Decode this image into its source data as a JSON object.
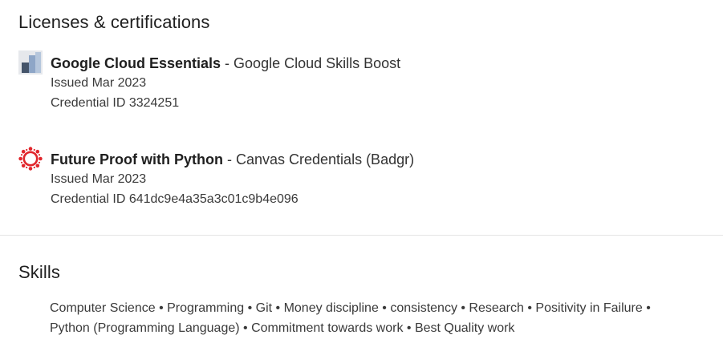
{
  "licenses": {
    "title": "Licenses & certifications",
    "items": [
      {
        "name": "Google Cloud Essentials",
        "separator": " - ",
        "issuer": "Google Cloud Skills Boost",
        "issued": "Issued Mar 2023",
        "credential": "Credential ID 3324251",
        "logo_icon": "google-cloud-skills-boost-logo"
      },
      {
        "name": "Future Proof with Python",
        "separator": " - ",
        "issuer": "Canvas Credentials (Badgr)",
        "issued": "Issued Mar 2023",
        "credential": "Credential ID 641dc9e4a35a3c01c9b4e096",
        "logo_icon": "canvas-credentials-logo"
      }
    ]
  },
  "skills": {
    "title": "Skills",
    "line1": "Computer Science • Programming • Git • Money discipline • consistency • Research • Positivity in Failure •",
    "line2": "Python (Programming Language) • Commitment towards work • Best Quality work"
  },
  "colors": {
    "text_primary": "#1f1f1f",
    "text_secondary": "#3a3a3a",
    "divider": "#e4e4e4",
    "canvas_red": "#e1262c"
  }
}
